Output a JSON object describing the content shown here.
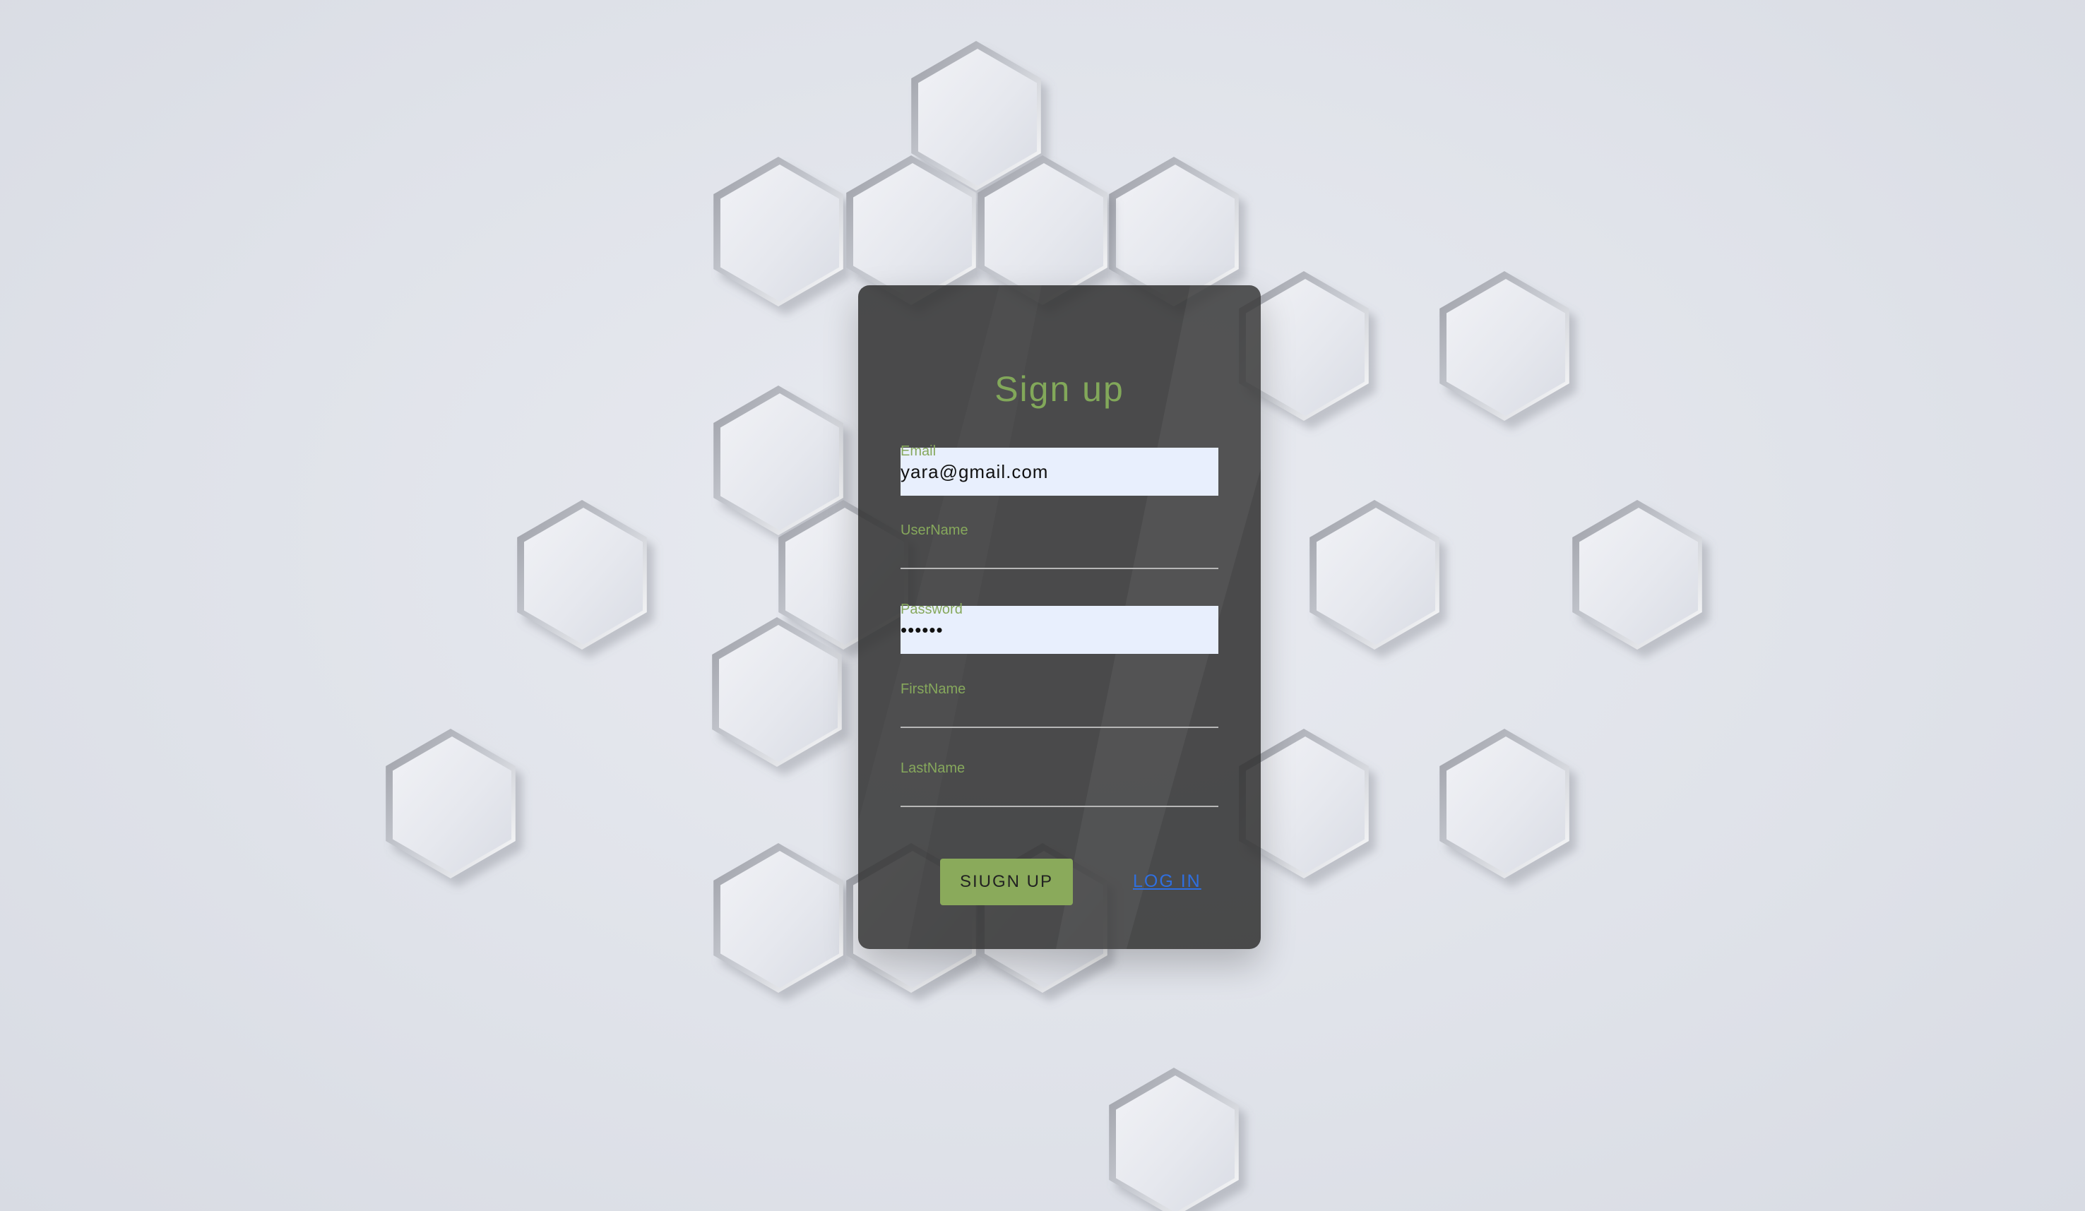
{
  "background": {
    "color": "#dfe2e9",
    "pattern": "embossed-hexagons"
  },
  "form": {
    "title": "Sign up",
    "accent_color": "#86a85c",
    "fields": {
      "email": {
        "label": "Email",
        "value": "yara@gmail.com"
      },
      "username": {
        "label": "UserName",
        "value": ""
      },
      "password": {
        "label": "Password",
        "value": "••••••"
      },
      "firstname": {
        "label": "FirstName",
        "value": ""
      },
      "lastname": {
        "label": "LastName",
        "value": ""
      }
    },
    "signup_button": "SIUGN UP",
    "login_link": "LOG IN",
    "link_color": "#2f6fe0"
  }
}
